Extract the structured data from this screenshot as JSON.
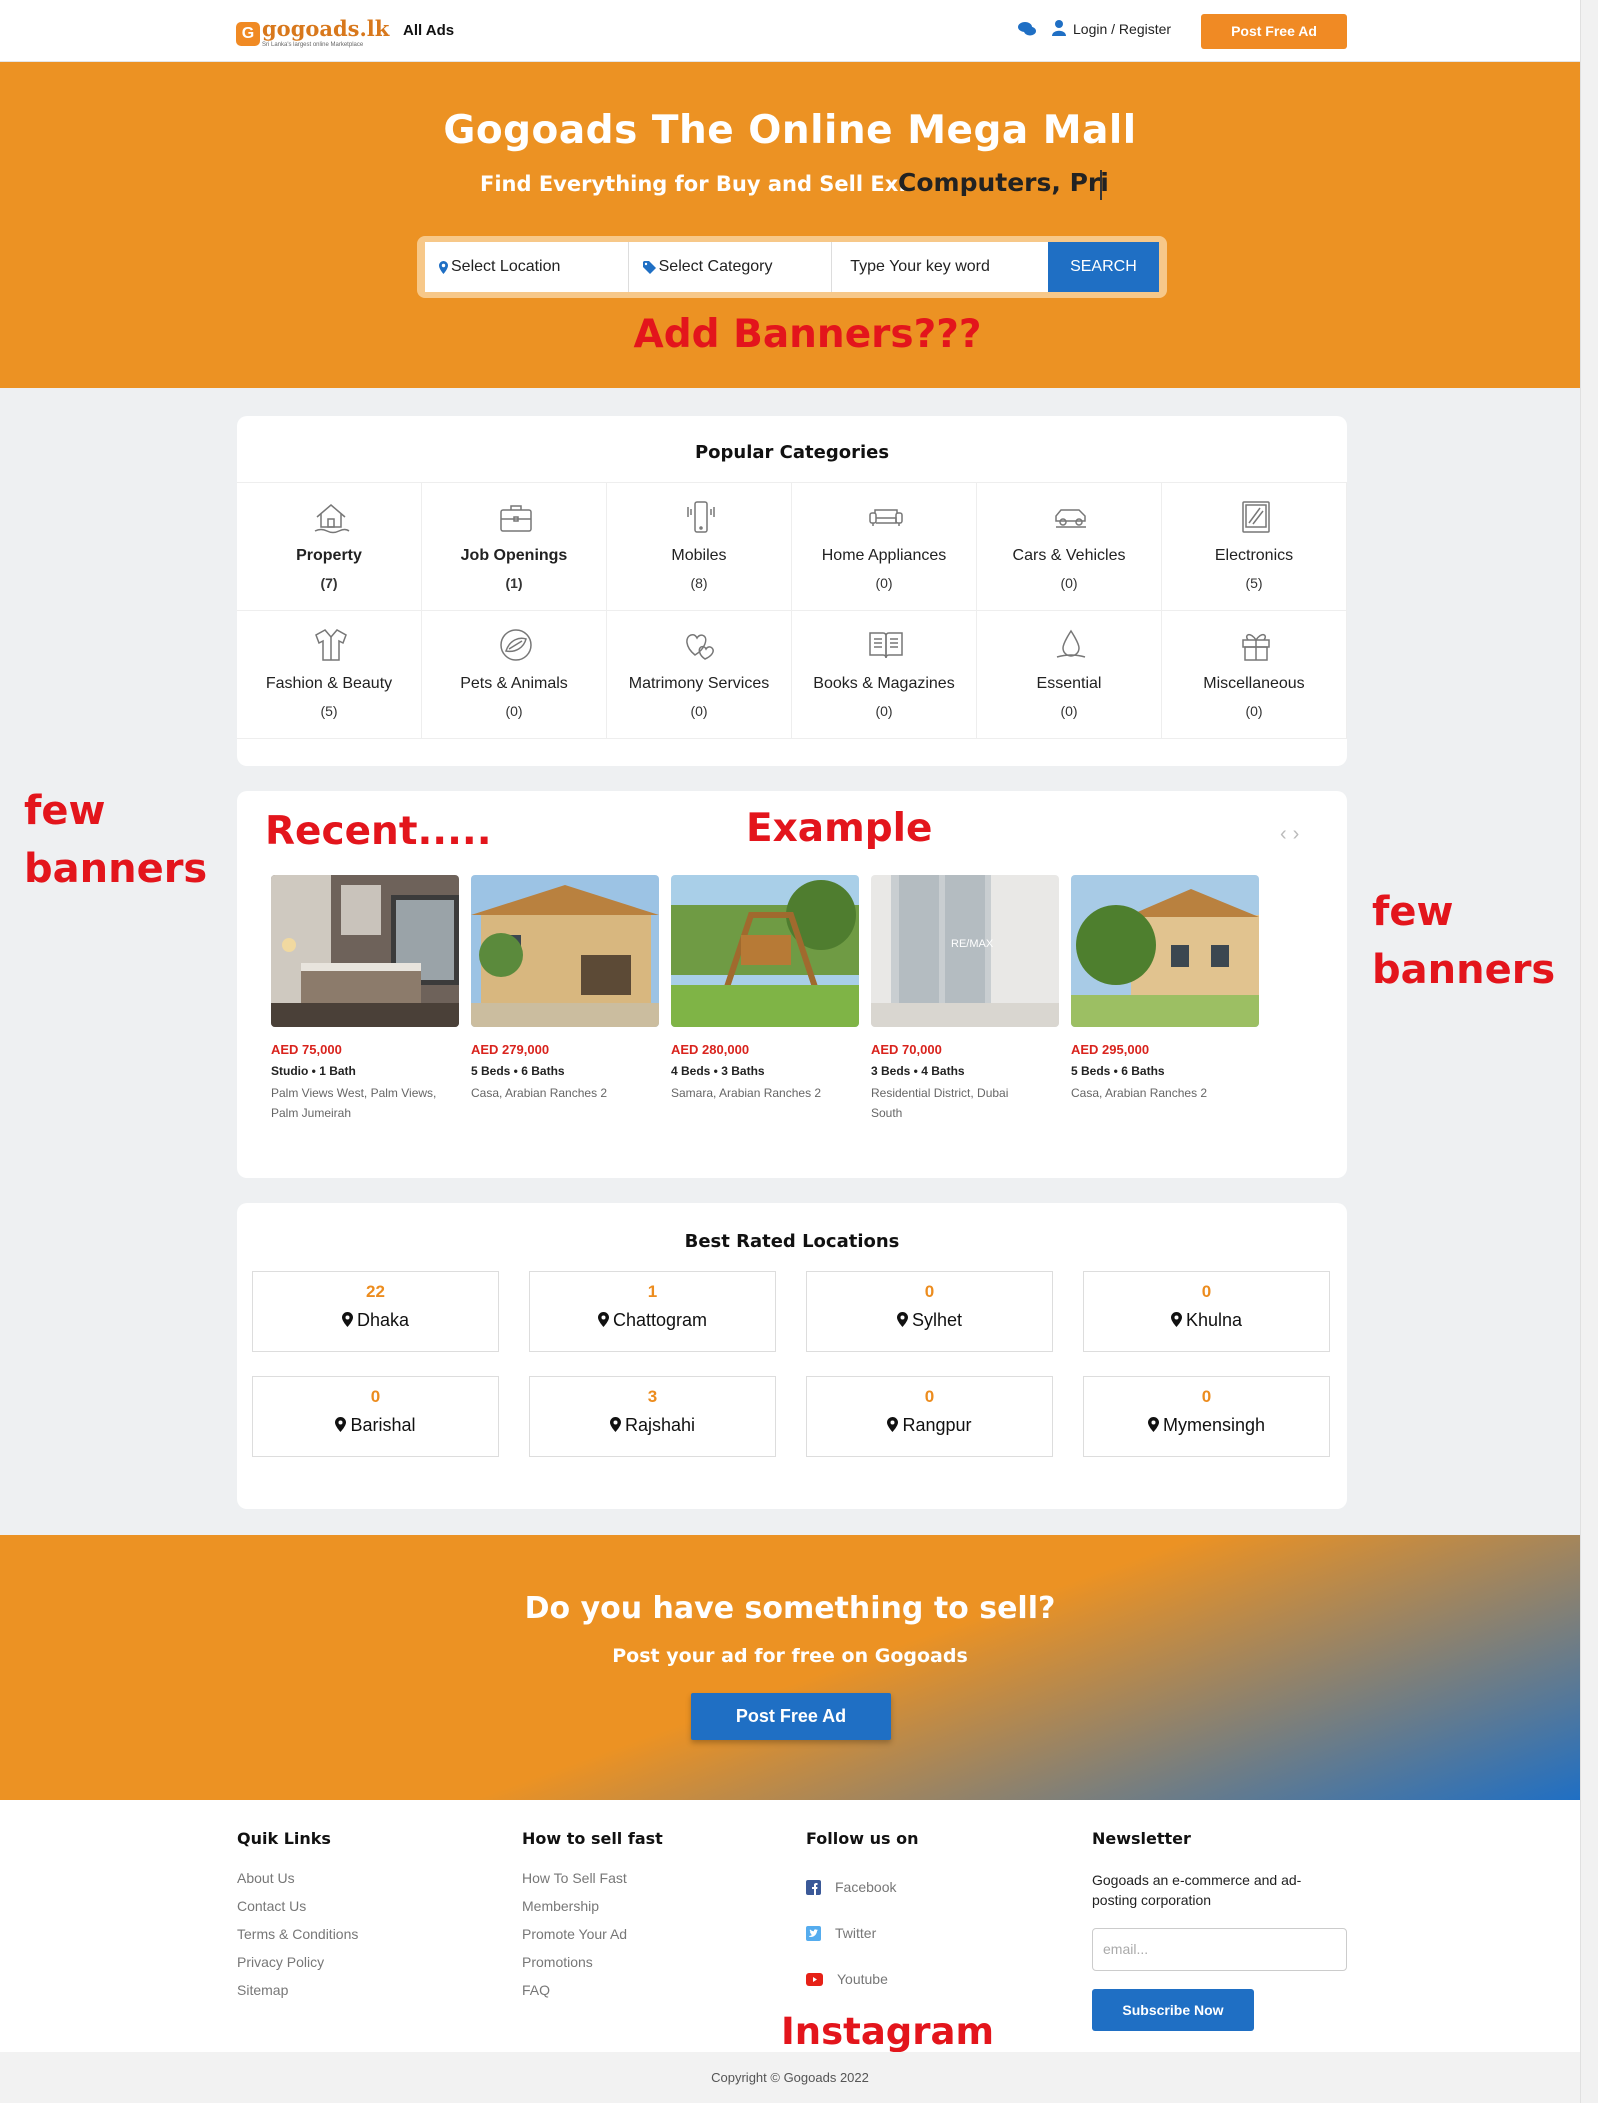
{
  "nav": {
    "logo_text": "gogoads.lk",
    "logo_tagline": "Sri Lanka's largest online Marketplace",
    "all_ads": "All Ads",
    "login": "Login",
    "register": "/ Register",
    "post_free_ad": "Post Free Ad"
  },
  "hero": {
    "title": "Gogoads The Online Mega Mall",
    "subtitle": "Find Everything for Buy and Sell Ex.",
    "typed_text": "Computers, Pri",
    "search": {
      "location": "Select Location",
      "category": "Select Category",
      "keyword_placeholder": "Type Your key word",
      "button": "SEARCH"
    }
  },
  "annotations": {
    "add_banners": "Add Banners???",
    "few_banners_left_1": "few",
    "few_banners_left_2": "banners",
    "few_banners_right_1": "few",
    "few_banners_right_2": "banners",
    "recent": "Recent.....",
    "example": "Example",
    "instagram": "Instagram"
  },
  "popular_categories": {
    "title": "Popular Categories",
    "items": [
      {
        "name": "Property",
        "count": "(7)",
        "icon": "house-icon",
        "bold": true
      },
      {
        "name": "Job Openings",
        "count": "(1)",
        "icon": "briefcase-icon",
        "bold": true
      },
      {
        "name": "Mobiles",
        "count": "(8)",
        "icon": "mobile-icon",
        "bold": false
      },
      {
        "name": "Home Appliances",
        "count": "(0)",
        "icon": "sofa-icon",
        "bold": false
      },
      {
        "name": "Cars & Vehicles",
        "count": "(0)",
        "icon": "car-icon",
        "bold": false
      },
      {
        "name": "Electronics",
        "count": "(5)",
        "icon": "tablet-icon",
        "bold": false
      },
      {
        "name": "Fashion & Beauty",
        "count": "(5)",
        "icon": "shirt-icon",
        "bold": false
      },
      {
        "name": "Pets & Animals",
        "count": "(0)",
        "icon": "pet-icon",
        "bold": false
      },
      {
        "name": "Matrimony Services",
        "count": "(0)",
        "icon": "hearts-icon",
        "bold": false
      },
      {
        "name": "Books & Magazines",
        "count": "(0)",
        "icon": "book-icon",
        "bold": false
      },
      {
        "name": "Essential",
        "count": "(0)",
        "icon": "drop-icon",
        "bold": false
      },
      {
        "name": "Miscellaneous",
        "count": "(0)",
        "icon": "gift-icon",
        "bold": false
      }
    ]
  },
  "recent": {
    "listings": [
      {
        "price": "AED 75,000",
        "specs": "Studio • 1 Bath",
        "location": "Palm Views West, Palm Views, Palm Jumeirah"
      },
      {
        "price": "AED 279,000",
        "specs": "5 Beds • 6 Baths",
        "location": "Casa, Arabian Ranches 2"
      },
      {
        "price": "AED 280,000",
        "specs": "4 Beds • 3 Baths",
        "location": "Samara, Arabian Ranches 2"
      },
      {
        "price": "AED 70,000",
        "specs": "3 Beds • 4 Baths",
        "location": "Residential District, Dubai South"
      },
      {
        "price": "AED 295,000",
        "specs": "5 Beds • 6 Baths",
        "location": "Casa, Arabian Ranches 2"
      }
    ],
    "watermark": "RE/MAX"
  },
  "locations": {
    "title": "Best Rated Locations",
    "items": [
      {
        "count": "22",
        "name": "Dhaka"
      },
      {
        "count": "1",
        "name": "Chattogram"
      },
      {
        "count": "0",
        "name": "Sylhet"
      },
      {
        "count": "0",
        "name": "Khulna"
      },
      {
        "count": "0",
        "name": "Barishal"
      },
      {
        "count": "3",
        "name": "Rajshahi"
      },
      {
        "count": "0",
        "name": "Rangpur"
      },
      {
        "count": "0",
        "name": "Mymensingh"
      }
    ]
  },
  "cta": {
    "title": "Do you have something to sell?",
    "subtitle": "Post your ad for free on Gogoads",
    "button": "Post Free Ad"
  },
  "footer": {
    "quick_links": {
      "title": "Quik Links",
      "items": [
        "About Us",
        "Contact Us",
        "Terms & Conditions",
        "Privacy Policy",
        "Sitemap"
      ]
    },
    "sell_fast": {
      "title": "How to sell fast",
      "items": [
        "How To Sell Fast",
        "Membership",
        "Promote Your Ad",
        "Promotions",
        "FAQ"
      ]
    },
    "follow": {
      "title": "Follow us on",
      "items": [
        "Facebook",
        "Twitter",
        "Youtube"
      ]
    },
    "newsletter": {
      "title": "Newsletter",
      "text": "Gogoads an e-commerce and ad-posting corporation",
      "placeholder": "email...",
      "button": "Subscribe Now"
    },
    "copyright": "Copyright © Gogoads 2022"
  },
  "colors": {
    "brand_orange": "#ec9223",
    "brand_blue": "#1f6fc4",
    "annotation_red": "#e3151c",
    "price_red": "#d9231d"
  }
}
